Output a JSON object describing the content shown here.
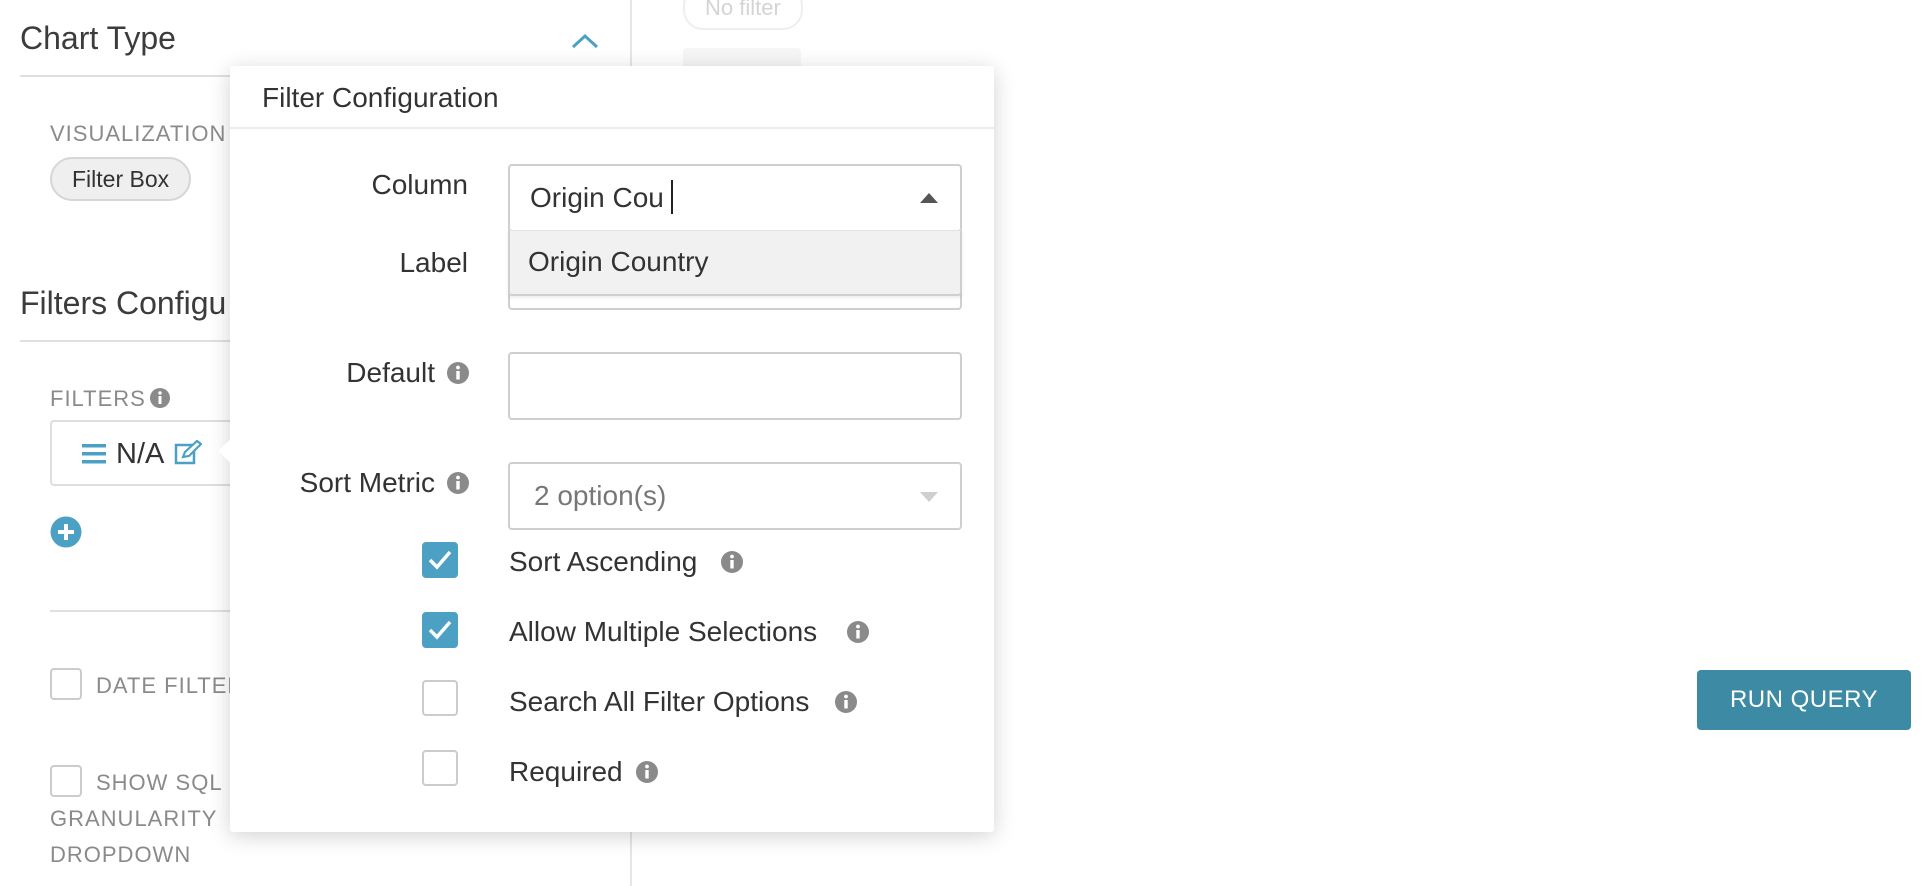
{
  "left": {
    "chart_type_title": "Chart Type",
    "visualization_label": "VISUALIZATION",
    "visualization_value": "Filter Box",
    "filters_config_title": "Filters Configu",
    "filters_label": "FILTERS",
    "filter_item_label": "N/A",
    "date_filter_label": "DATE FILTER",
    "show_sql_label_1": "SHOW SQL",
    "show_sql_label_2": "GRANULARITY",
    "show_sql_label_3": "DROPDOWN"
  },
  "right": {
    "no_filter_label": "No filter",
    "run_query_label": "RUN QUERY"
  },
  "popover": {
    "title": "Filter Configuration",
    "column_label": "Column",
    "column_input_value": "Origin Cou",
    "column_dropdown_option": "Origin Country",
    "label_label": "Label",
    "default_label": "Default",
    "sort_metric_label": "Sort Metric",
    "sort_metric_value": "2 option(s)",
    "sort_ascending_label": "Sort Ascending",
    "sort_ascending_checked": true,
    "allow_multiple_label": "Allow Multiple Selections",
    "allow_multiple_checked": true,
    "search_all_label": "Search All Filter Options",
    "search_all_checked": false,
    "required_label": "Required",
    "required_checked": false
  },
  "colors": {
    "accent": "#4ba0c4",
    "run_button": "#3d8aa5"
  },
  "icons": [
    "chevron-up-icon",
    "info-icon",
    "hamburger-icon",
    "edit-icon",
    "plus-circle-icon",
    "caret-up-icon",
    "caret-down-icon",
    "check-icon"
  ]
}
